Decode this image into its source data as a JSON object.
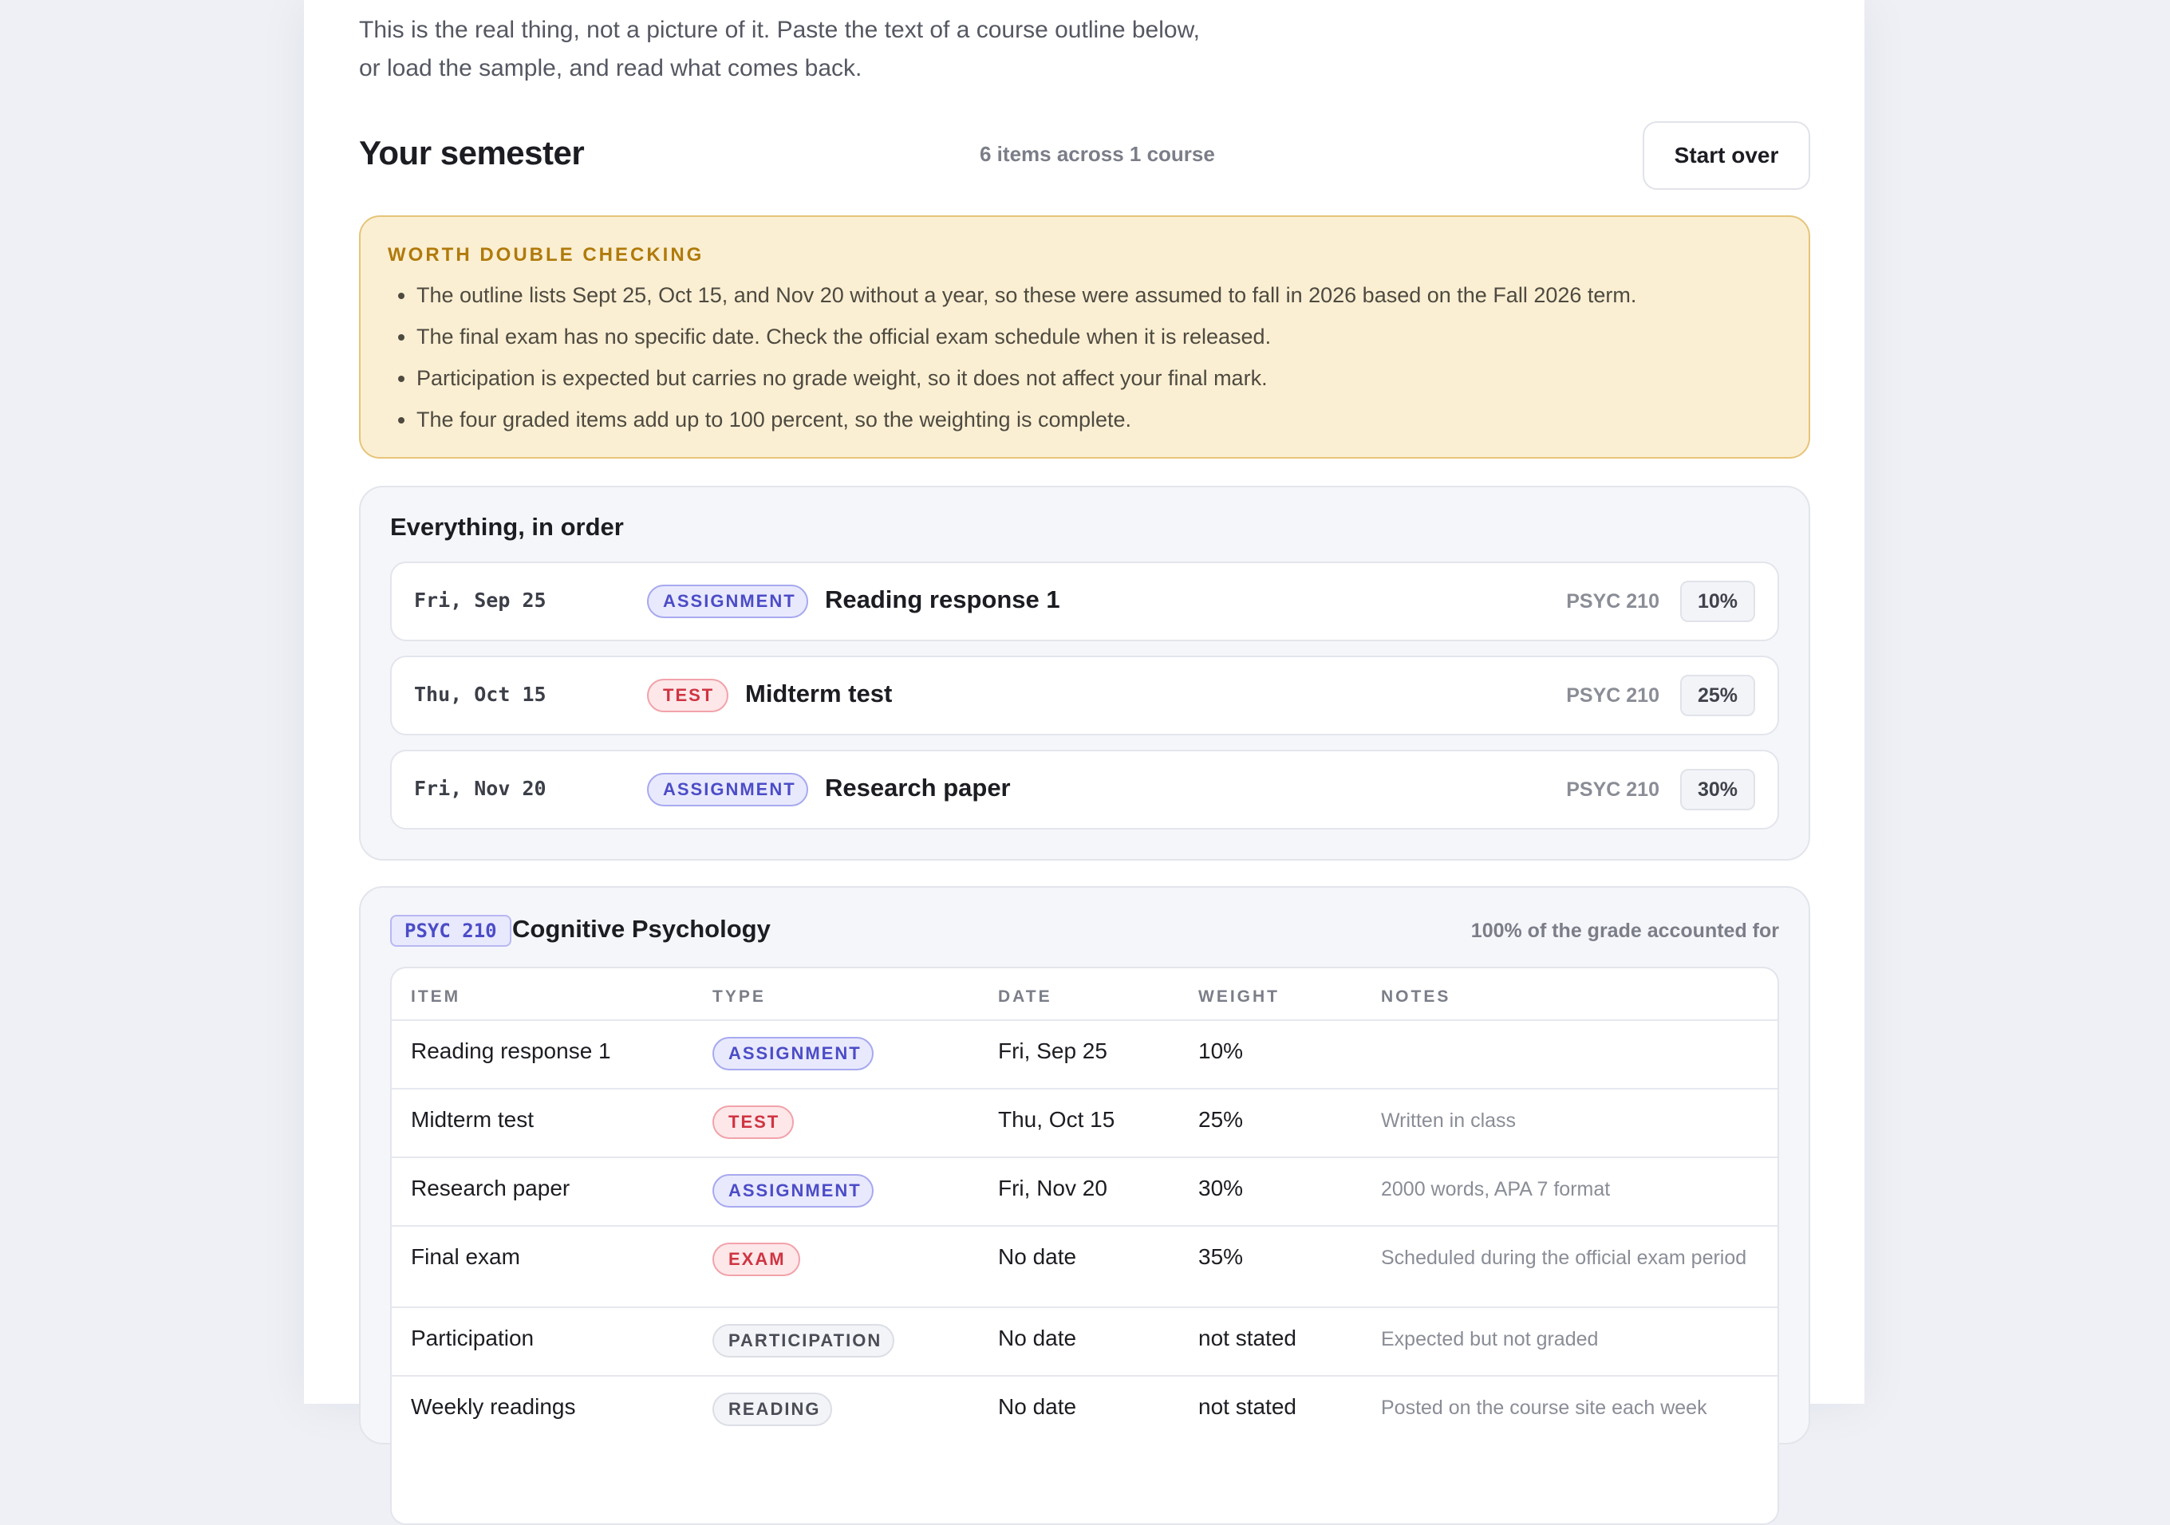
{
  "intro": "This is the real thing, not a picture of it. Paste the text of a course outline below, or load the sample, and read what comes back.",
  "semester": {
    "title": "Your semester",
    "count": "6 items across 1 course",
    "start_over": "Start over"
  },
  "warning": {
    "title": "WORTH DOUBLE CHECKING",
    "items": [
      "The outline lists Sept 25, Oct 15, and Nov 20 without a year, so these were assumed to fall in 2026 based on the Fall 2026 term.",
      "The final exam has no specific date. Check the official exam schedule when it is released.",
      "Participation is expected but carries no grade weight, so it does not affect your final mark.",
      "The four graded items add up to 100 percent, so the weighting is complete."
    ]
  },
  "timeline": {
    "title": "Everything, in order",
    "rows": [
      {
        "date": "Fri, Sep 25",
        "type": "ASSIGNMENT",
        "title": "Reading response 1",
        "course": "PSYC 210",
        "weight": "10%"
      },
      {
        "date": "Thu, Oct 15",
        "type": "TEST",
        "title": "Midterm test",
        "course": "PSYC 210",
        "weight": "25%"
      },
      {
        "date": "Fri, Nov 20",
        "type": "ASSIGNMENT",
        "title": "Research paper",
        "course": "PSYC 210",
        "weight": "30%"
      }
    ]
  },
  "course": {
    "code": "PSYC 210",
    "name": "Cognitive Psychology",
    "accounted": "100% of the grade accounted for",
    "headers": [
      "ITEM",
      "TYPE",
      "DATE",
      "WEIGHT",
      "NOTES"
    ],
    "rows": [
      {
        "item": "Reading response 1",
        "type": "ASSIGNMENT",
        "date": "Fri, Sep 25",
        "weight": "10%",
        "notes": ""
      },
      {
        "item": "Midterm test",
        "type": "TEST",
        "date": "Thu, Oct 15",
        "weight": "25%",
        "notes": "Written in class"
      },
      {
        "item": "Research paper",
        "type": "ASSIGNMENT",
        "date": "Fri, Nov 20",
        "weight": "30%",
        "notes": "2000 words, APA 7 format"
      },
      {
        "item": "Final exam",
        "type": "EXAM",
        "date": "No date",
        "weight": "35%",
        "notes": "Scheduled during the official exam period"
      },
      {
        "item": "Participation",
        "type": "PARTICIPATION",
        "date": "No date",
        "weight": "not stated",
        "notes": "Expected but not graded"
      },
      {
        "item": "Weekly readings",
        "type": "READING",
        "date": "No date",
        "weight": "not stated",
        "notes": "Posted on the course site each week"
      }
    ]
  }
}
